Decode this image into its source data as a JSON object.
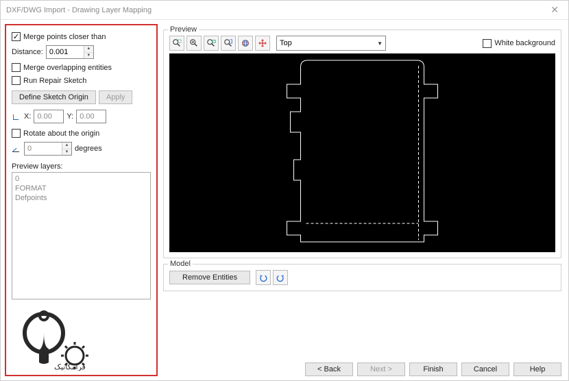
{
  "window": {
    "title": "DXF/DWG Import - Drawing Layer Mapping"
  },
  "left": {
    "merge_points_label": "Merge points closer than",
    "distance_label": "Distance:",
    "distance_value": "0.001",
    "merge_overlap_label": "Merge overlapping entities",
    "run_repair_label": "Run Repair Sketch",
    "define_origin_btn": "Define Sketch Origin",
    "apply_btn": "Apply",
    "x_label": "X:",
    "x_value": "0.00",
    "y_label": "Y:",
    "y_value": "0.00",
    "rotate_label": "Rotate about the origin",
    "angle_value": "0",
    "degrees_label": "degrees",
    "preview_layers_label": "Preview layers:",
    "layers": [
      "0",
      "FORMAT",
      "Defpoints"
    ]
  },
  "preview": {
    "legend": "Preview",
    "view_dropdown": "Top",
    "white_bg_label": "White background"
  },
  "model": {
    "legend": "Model",
    "remove_entities_btn": "Remove Entities"
  },
  "footer": {
    "back": "< Back",
    "next": "Next >",
    "finish": "Finish",
    "cancel": "Cancel",
    "help": "Help"
  },
  "icons": {
    "zoom_box": "zoom-box-icon",
    "zoom_in": "zoom-in-icon",
    "zoom_out": "zoom-out-icon",
    "zoom_fit": "zoom-fit-icon",
    "rotate3d": "rotate-3d-icon",
    "pan": "pan-icon",
    "undo": "undo-icon",
    "redo": "redo-icon"
  }
}
